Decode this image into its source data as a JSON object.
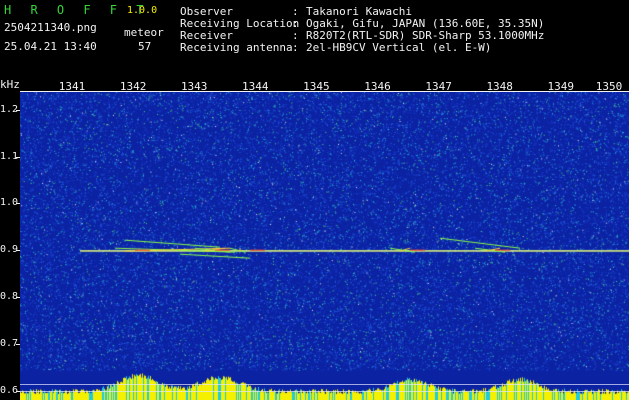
{
  "header": {
    "brand": "H R O F F T",
    "version": "1.0.0",
    "file": "2504211340.png",
    "datetime": "25.04.21 13:40",
    "count_label": "meteor",
    "count_value": "57",
    "rows": [
      {
        "label": "Observer",
        "sep": ":",
        "value": "Takanori Kawachi"
      },
      {
        "label": "Receiving Location",
        "sep": ":",
        "value": "Ogaki, Gifu, JAPAN (136.60E, 35.35N)"
      },
      {
        "label": "Receiver",
        "sep": ":",
        "value": "R820T2(RTL-SDR) SDR-Sharp 53.1000MHz"
      },
      {
        "label": "Receiving antenna",
        "sep": ":",
        "value": "2el-HB9CV Vertical (el. E-W)"
      }
    ]
  },
  "spectrogram": {
    "y_unit": "kHz",
    "y_ticks": [
      "1.2",
      "1.1",
      "1.0",
      "0.9",
      "0.8",
      "0.7",
      "0.6"
    ],
    "x_ticks": [
      "1341",
      "1342",
      "1343",
      "1344",
      "1345",
      "1346",
      "1347",
      "1348",
      "1349",
      "1350"
    ],
    "ylim": [
      0.58,
      1.24
    ],
    "carrier_khz": 0.9,
    "background_color": "#0b22a3",
    "noise_colors": [
      "#1a3fd0",
      "#2a6ef0",
      "#24c4d8",
      "#4fe07a",
      "#f2f2f2"
    ],
    "trace_color": "#e8ff7a",
    "echo_colors": [
      "#ff3a2a",
      "#ffd23a",
      "#8aff4a"
    ],
    "power_bar_colors": [
      "#f5f000",
      "#1ecbe1"
    ]
  }
}
